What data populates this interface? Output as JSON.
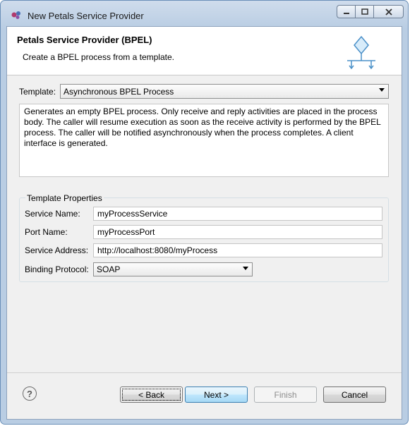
{
  "window": {
    "title": "New Petals Service Provider",
    "controls": {
      "minimize": "▭",
      "maximize": "☐",
      "close": "✕"
    }
  },
  "header": {
    "title": "Petals Service Provider (BPEL)",
    "description": "Create a BPEL process from a template."
  },
  "template": {
    "label": "Template:",
    "selected": "Asynchronous BPEL Process",
    "description": "Generates an empty BPEL process. Only receive and reply activities are placed in the process body. The caller will resume execution as soon as the receive activity is performed by the BPEL process. The caller will be notified asynchronously when the process completes. A client interface is generated."
  },
  "properties": {
    "group_title": "Template Properties",
    "service_name": {
      "label": "Service Name:",
      "value": "myProcessService"
    },
    "port_name": {
      "label": "Port Name:",
      "value": "myProcessPort"
    },
    "service_address": {
      "label": "Service Address:",
      "value": "http://localhost:8080/myProcess"
    },
    "binding_protocol": {
      "label": "Binding Protocol:",
      "value": "SOAP"
    }
  },
  "footer": {
    "help": "?",
    "back": "< Back",
    "next": "Next >",
    "finish": "Finish",
    "cancel": "Cancel"
  },
  "colors": {
    "accent": "#3c7fb1",
    "graphic": "#4a90c8"
  }
}
